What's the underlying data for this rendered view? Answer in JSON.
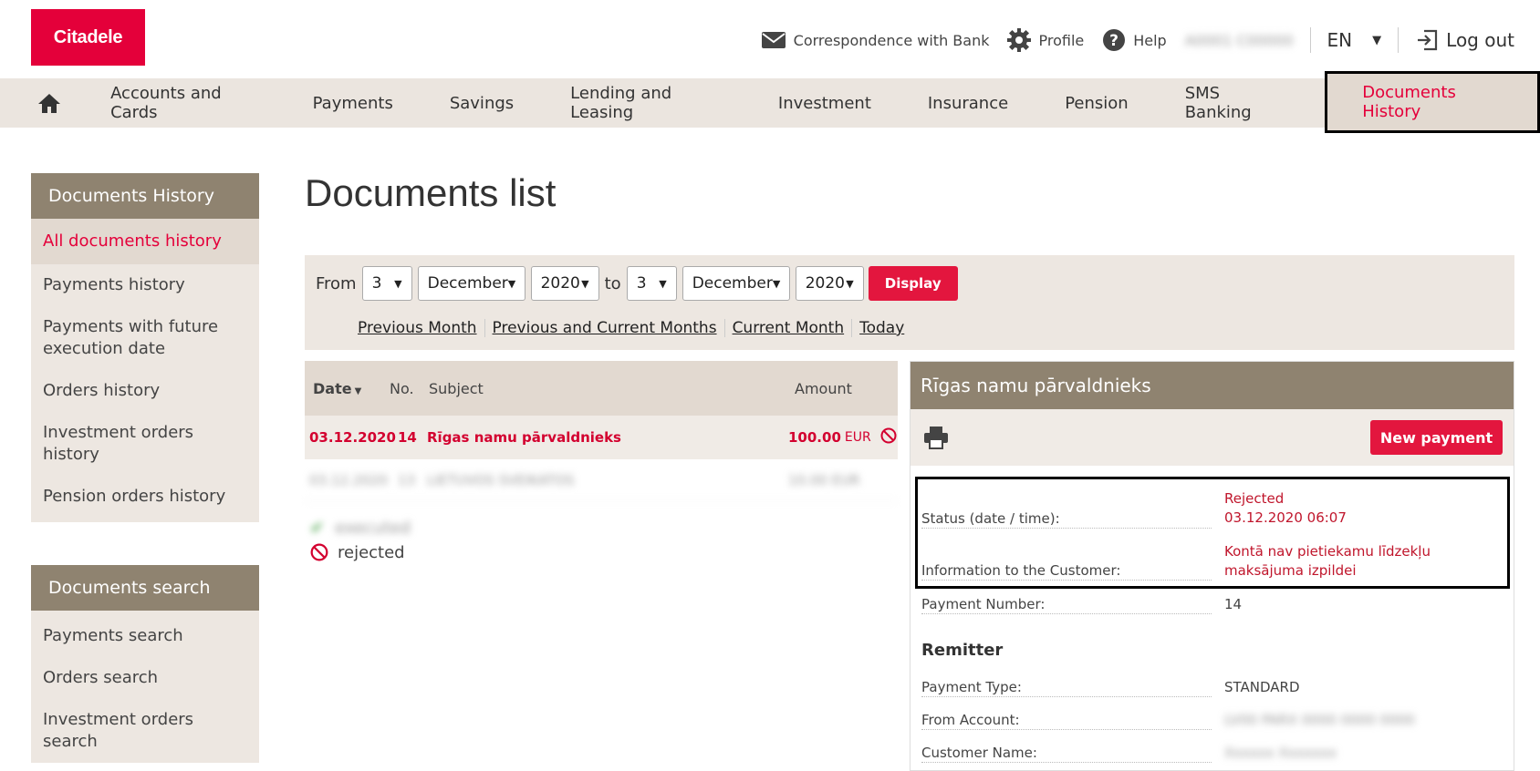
{
  "brand": {
    "logo_text": "Citadele",
    "accent": "#e4003a"
  },
  "topbar": {
    "correspondence": "Correspondence with Bank",
    "profile": "Profile",
    "help": "Help",
    "user_masked": "A0001 C00000",
    "lang": "EN",
    "logout": "Log out"
  },
  "nav": {
    "items": [
      "Accounts and Cards",
      "Payments",
      "Savings",
      "Lending and Leasing",
      "Investment",
      "Insurance",
      "Pension",
      "SMS Banking"
    ],
    "active": "Documents History"
  },
  "sidebar": {
    "history_title": "Documents History",
    "history_links": [
      "All documents history",
      "Payments history",
      "Payments with future execution date",
      "Orders history",
      "Investment orders history",
      "Pension orders history"
    ],
    "search_title": "Documents search",
    "search_links": [
      "Payments search",
      "Orders search",
      "Investment orders search"
    ]
  },
  "main": {
    "title": "Documents list",
    "filter": {
      "from_label": "From",
      "to_label": "to",
      "from_day": "3",
      "from_month": "December",
      "from_year": "2020",
      "to_day": "3",
      "to_month": "December",
      "to_year": "2020",
      "display_btn": "Display",
      "quick": [
        "Previous Month",
        "Previous and Current Months",
        "Current Month",
        "Today"
      ]
    },
    "table": {
      "cols": {
        "date": "Date",
        "no": "No.",
        "subject": "Subject",
        "amount": "Amount"
      },
      "row1": {
        "date": "03.12.2020",
        "no": "14",
        "subject": "Rīgas namu pārvaldnieks",
        "amount": "100.00",
        "currency": "EUR"
      },
      "row2": {
        "date": "03.12.2020",
        "no": "13",
        "subject": "LIETUVOS SVEIKATOS",
        "amount": "10.00 EUR"
      }
    },
    "legend": {
      "executed": "executed",
      "rejected": "rejected"
    }
  },
  "detail": {
    "title": "Rīgas namu pārvaldnieks",
    "new_payment": "New payment",
    "status_label": "Status (date / time):",
    "status_value": "Rejected",
    "status_time": "03.12.2020 06:07",
    "info_label": "Information to the Customer:",
    "info_value": "Kontā nav pietiekamu līdzekļu maksājuma izpildei",
    "payment_number_label": "Payment Number:",
    "payment_number": "14",
    "remitter_title": "Remitter",
    "payment_type_label": "Payment Type:",
    "payment_type": "STANDARD",
    "from_account_label": "From Account:",
    "from_account_masked": "LV00 PARX 0000 0000 0000",
    "customer_name_label": "Customer Name:",
    "customer_name_masked": "Xxxxxx Xxxxxxx"
  }
}
